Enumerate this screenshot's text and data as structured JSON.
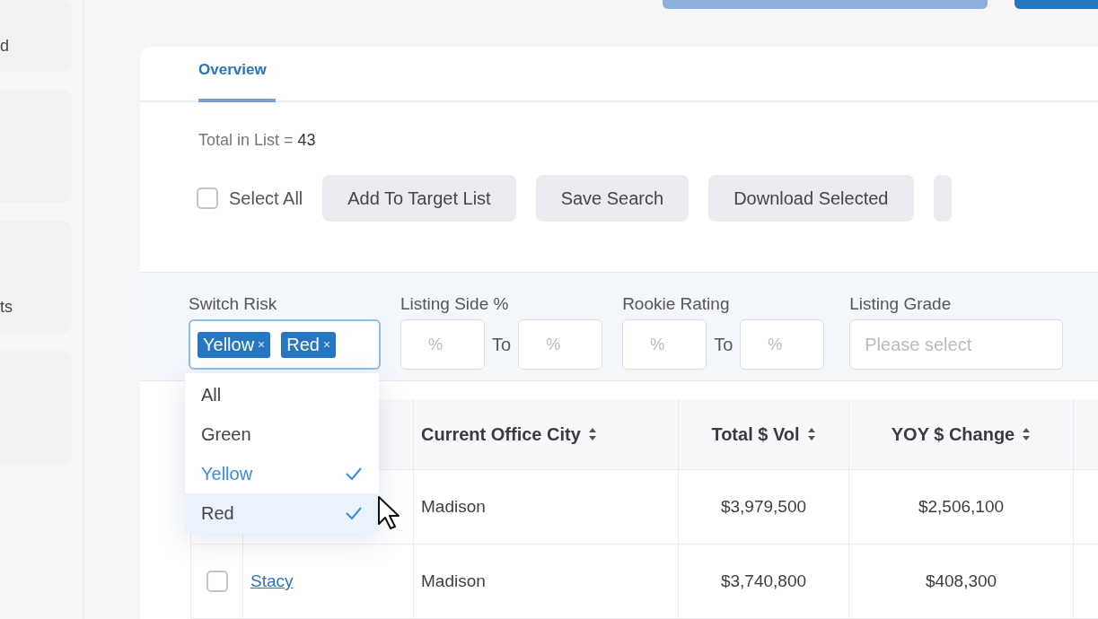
{
  "sidebar": {
    "items": [
      {
        "kind": "labeled",
        "label": "d"
      },
      {
        "kind": "blank"
      },
      {
        "kind": "labeled",
        "label": "ts"
      },
      {
        "kind": "blank"
      }
    ]
  },
  "tabs": [
    {
      "label": "Overview",
      "selected": true
    }
  ],
  "total": {
    "label": "Total in List =",
    "value": "43"
  },
  "toolbar": {
    "select_all": {
      "label": "Select All",
      "checked": false
    },
    "buttons": [
      "Add To Target List",
      "Save Search",
      "Download Selected"
    ]
  },
  "filters": {
    "switch_risk": {
      "label": "Switch Risk",
      "tags": [
        {
          "label": "Yellow",
          "remove": "×"
        },
        {
          "label": "Red",
          "remove": "×"
        }
      ],
      "options": [
        {
          "label": "All",
          "selected": false,
          "hovered": false
        },
        {
          "label": "Green",
          "selected": false,
          "hovered": false
        },
        {
          "label": "Yellow",
          "selected": true,
          "hovered": false
        },
        {
          "label": "Red",
          "selected": true,
          "hovered": true
        }
      ]
    },
    "ranges": [
      {
        "label": "Listing Side %",
        "from_placeholder": "%",
        "to": "To",
        "to_placeholder": "%"
      },
      {
        "label": "Rookie Rating",
        "from_placeholder": "%",
        "to": "To",
        "to_placeholder": "%"
      }
    ],
    "listing_grade": {
      "label": "Listing Grade",
      "placeholder": "Please select"
    }
  },
  "table": {
    "columns": [
      "Current Office City",
      "Total $ Vol",
      "YOY $ Change"
    ],
    "rows": [
      {
        "cells": [
          "Madison",
          "$3,979,500",
          "$2,506,100"
        ]
      },
      {
        "checked": false,
        "name": "Stacy",
        "cells": [
          "Madison",
          "$3,740,800",
          "$408,300"
        ]
      }
    ]
  }
}
